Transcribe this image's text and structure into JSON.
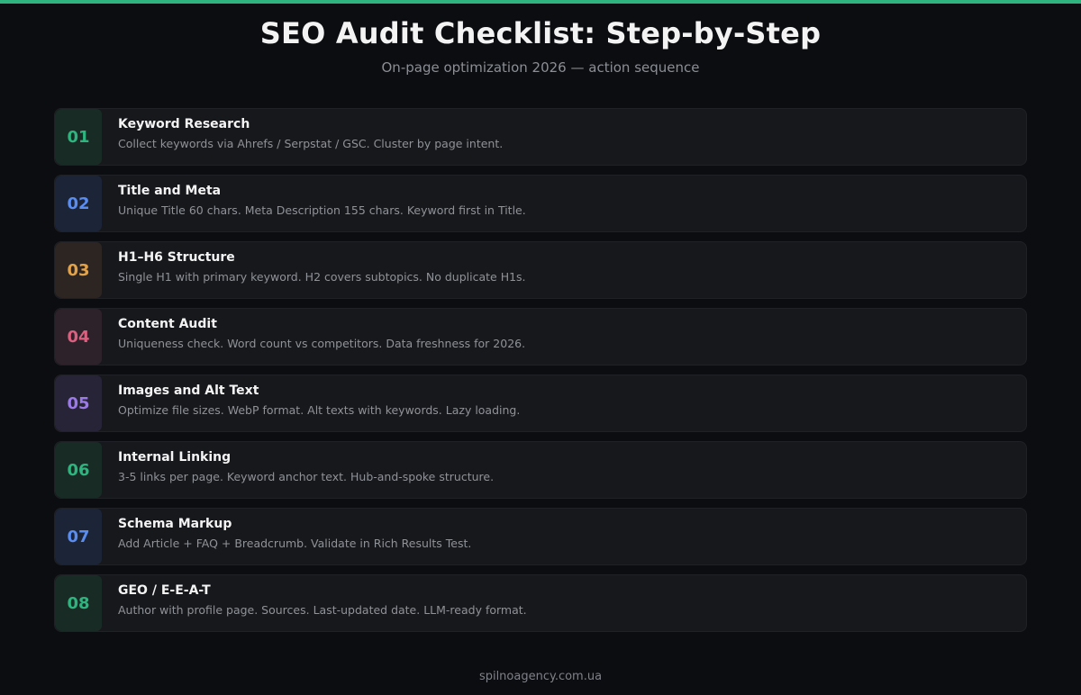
{
  "header": {
    "title": "SEO Audit Checklist: Step-by-Step",
    "subtitle": "On-page optimization 2026 — action sequence"
  },
  "steps": [
    {
      "num": "01",
      "title": "Keyword Research",
      "desc": "Collect keywords via Ahrefs / Serpstat / GSC. Cluster by page intent.",
      "num_color": "#2fb47f",
      "badge_bg": "#182b25"
    },
    {
      "num": "02",
      "title": "Title and Meta",
      "desc": "Unique Title 60 chars. Meta Description 155 chars. Keyword first in Title.",
      "num_color": "#5b8def",
      "badge_bg": "#1c2438"
    },
    {
      "num": "03",
      "title": "H1–H6 Structure",
      "desc": "Single H1 with primary keyword. H2 covers subtopics. No duplicate H1s.",
      "num_color": "#e2a24a",
      "badge_bg": "#2d2522"
    },
    {
      "num": "04",
      "title": "Content Audit",
      "desc": "Uniqueness check. Word count vs competitors. Data freshness for 2026.",
      "num_color": "#d9607f",
      "badge_bg": "#2d2229"
    },
    {
      "num": "05",
      "title": "Images and Alt Text",
      "desc": "Optimize file sizes. WebP format. Alt texts with keywords. Lazy loading.",
      "num_color": "#9b7ae8",
      "badge_bg": "#272438"
    },
    {
      "num": "06",
      "title": "Internal Linking",
      "desc": "3-5 links per page. Keyword anchor text. Hub-and-spoke structure.",
      "num_color": "#2fb47f",
      "badge_bg": "#182b25"
    },
    {
      "num": "07",
      "title": "Schema Markup",
      "desc": "Add Article + FAQ + Breadcrumb. Validate in Rich Results Test.",
      "num_color": "#5b8def",
      "badge_bg": "#1c2438"
    },
    {
      "num": "08",
      "title": "GEO / E-E-A-T",
      "desc": "Author with profile page. Sources. Last-updated date. LLM-ready format.",
      "num_color": "#2fb47f",
      "badge_bg": "#182b25"
    }
  ],
  "footer": {
    "text": "spilnoagency.com.ua"
  },
  "colors": {
    "accent": "#2fb47f",
    "background": "#0c0d10",
    "card": "#17181c"
  }
}
